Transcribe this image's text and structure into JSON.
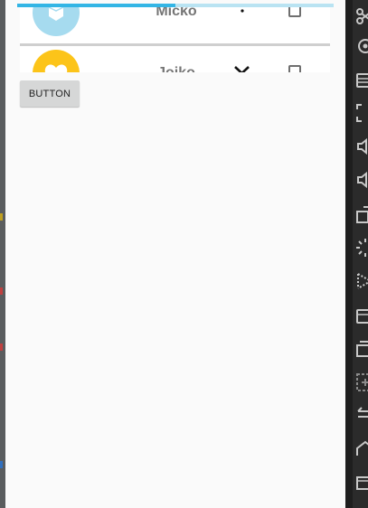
{
  "progress": {
    "value": 0.5
  },
  "list": {
    "items": [
      {
        "name": "Micko",
        "status_icon": "dot-icon",
        "checked": false,
        "avatar_color": "#a6dbef"
      },
      {
        "name": "Jojko",
        "status_icon": "close-icon",
        "checked": false,
        "avatar_color": "#fcc419"
      }
    ]
  },
  "button": {
    "label": "BUTTON"
  },
  "toolbar": {
    "icons": [
      "scissors-icon",
      "location-icon",
      "layers-icon",
      "fullscreen-icon",
      "volume-down-icon",
      "volume-up-icon",
      "rotate-icon",
      "spinner-icon",
      "screen-record-icon",
      "camera-icon",
      "window-icon",
      "zoom-icon",
      "back-icon",
      "home-icon",
      "overview-icon"
    ]
  },
  "colors": {
    "accent": "#33b5e5",
    "accent_track": "#b9e3f2",
    "screen_bg": "#fafafa"
  }
}
